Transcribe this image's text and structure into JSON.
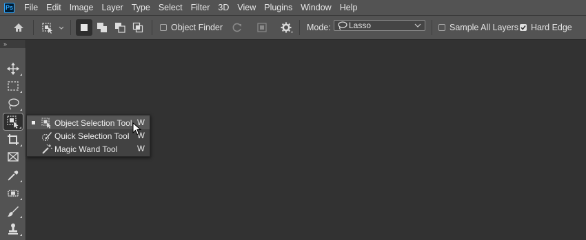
{
  "app": {
    "logo_text": "Ps"
  },
  "menu": [
    "File",
    "Edit",
    "Image",
    "Layer",
    "Type",
    "Select",
    "Filter",
    "3D",
    "View",
    "Plugins",
    "Window",
    "Help"
  ],
  "options": {
    "object_finder_label": "Object Finder",
    "object_finder_checked": false,
    "mode_label": "Mode:",
    "mode_value": "Lasso",
    "sample_all_layers_label": "Sample All Layers",
    "sample_all_layers_checked": false,
    "hard_edge_label": "Hard Edge",
    "hard_edge_checked": true
  },
  "toolbar": {
    "collapse_label": "»",
    "tools": [
      "move-tool",
      "marquee-tool",
      "lasso-tool",
      "object-selection-tool",
      "crop-tool",
      "frame-tool",
      "eyedropper-tool",
      "healing-brush-tool",
      "brush-tool",
      "clone-stamp-tool"
    ]
  },
  "flyout": {
    "items": [
      {
        "label": "Object Selection Tool",
        "shortcut": "W",
        "selected": true
      },
      {
        "label": "Quick Selection Tool",
        "shortcut": "W",
        "selected": false
      },
      {
        "label": "Magic Wand Tool",
        "shortcut": "W",
        "selected": false
      }
    ]
  },
  "colors": {
    "panel": "#535353",
    "canvas": "#323232",
    "menu_text": "#e8e8e8"
  }
}
